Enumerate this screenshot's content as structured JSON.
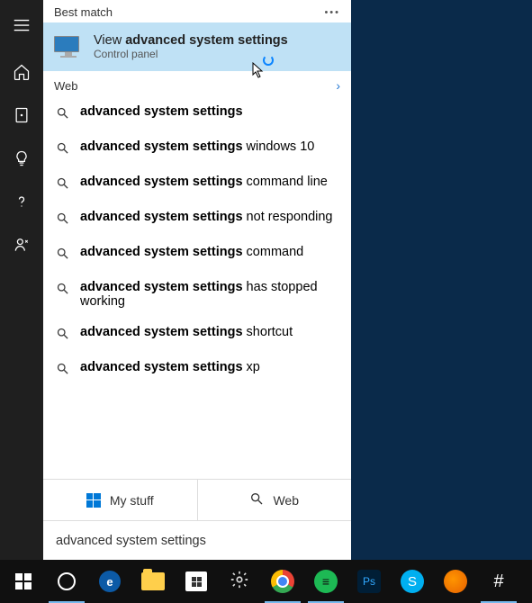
{
  "sidebar": {
    "items": [
      {
        "name": "menu"
      },
      {
        "name": "home"
      },
      {
        "name": "documents"
      },
      {
        "name": "tips"
      },
      {
        "name": "help"
      },
      {
        "name": "account"
      }
    ]
  },
  "search": {
    "header": "Best match",
    "best_match": {
      "title_prefix": "View ",
      "title_bold": "advanced system settings",
      "subtitle": "Control panel"
    },
    "web_header": "Web",
    "suggestions": [
      {
        "bold": "advanced system settings",
        "rest": ""
      },
      {
        "bold": "advanced system settings",
        "rest": " windows 10"
      },
      {
        "bold": "advanced system settings",
        "rest": " command line"
      },
      {
        "bold": "advanced system settings",
        "rest": " not responding"
      },
      {
        "bold": "advanced system settings",
        "rest": " command"
      },
      {
        "bold": "advanced system settings",
        "rest": " has stopped working"
      },
      {
        "bold": "advanced system settings",
        "rest": " shortcut"
      },
      {
        "bold": "advanced system settings",
        "rest": " xp"
      }
    ],
    "scope": {
      "mystuff": "My stuff",
      "web": "Web"
    },
    "input_value": "advanced system settings"
  },
  "taskbar": {
    "items": [
      {
        "name": "start",
        "active": false
      },
      {
        "name": "cortana",
        "active": true
      },
      {
        "name": "edge",
        "active": false
      },
      {
        "name": "file-explorer",
        "active": false
      },
      {
        "name": "store",
        "active": false
      },
      {
        "name": "settings",
        "active": false
      },
      {
        "name": "chrome",
        "active": true
      },
      {
        "name": "spotify",
        "active": true
      },
      {
        "name": "photoshop",
        "active": false
      },
      {
        "name": "skype",
        "active": false
      },
      {
        "name": "firefox",
        "active": false
      },
      {
        "name": "slack",
        "active": true
      }
    ]
  }
}
